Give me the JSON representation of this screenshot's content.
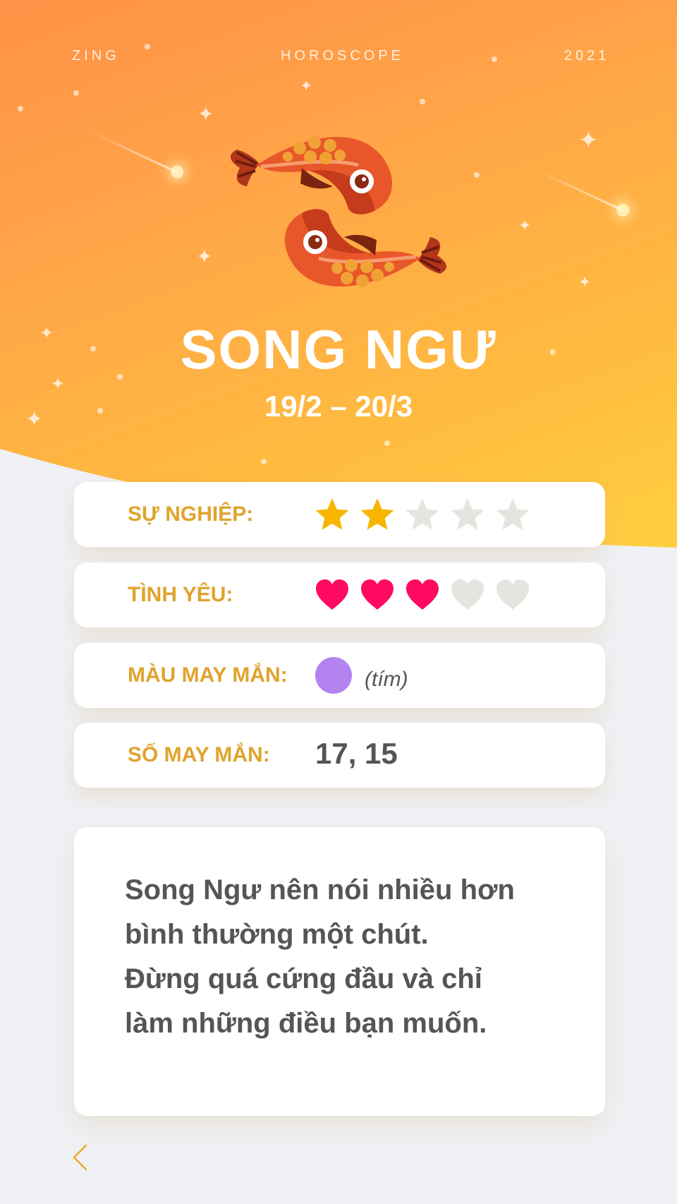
{
  "header": {
    "left": "ZING",
    "center": "HOROSCOPE",
    "right": "2021"
  },
  "sign": {
    "name": "SONG NGƯ",
    "dates": "19/2 – 20/3",
    "icon": "pisces-fish-icon"
  },
  "career": {
    "label": "SỰ NGHIỆP:",
    "rating": 2,
    "max": 5,
    "icon": "star-icon",
    "filled_color": "#f7b500",
    "empty_color": "#e6e4df"
  },
  "love": {
    "label": "TÌNH YÊU:",
    "rating": 3,
    "max": 5,
    "icon": "heart-icon",
    "filled_color": "#ff0a63",
    "empty_color": "#e6e4df"
  },
  "lucky_color": {
    "label": "MÀU MAY MẮN:",
    "swatch": "#b383f0",
    "name": "(tím)"
  },
  "lucky_number": {
    "label": "SỐ MAY MẮN:",
    "value": "17, 15"
  },
  "advice": {
    "lines": [
      "Song Ngư nên nói nhiều hơn",
      "bình thường một chút.",
      "Đừng quá cứng đầu và chỉ",
      "làm những điều bạn muốn."
    ]
  },
  "colors": {
    "accent": "#e0a32c",
    "text": "#555555",
    "hero_top": "#ff9146",
    "hero_bottom": "#ffd040",
    "background": "#f0f1f5"
  }
}
